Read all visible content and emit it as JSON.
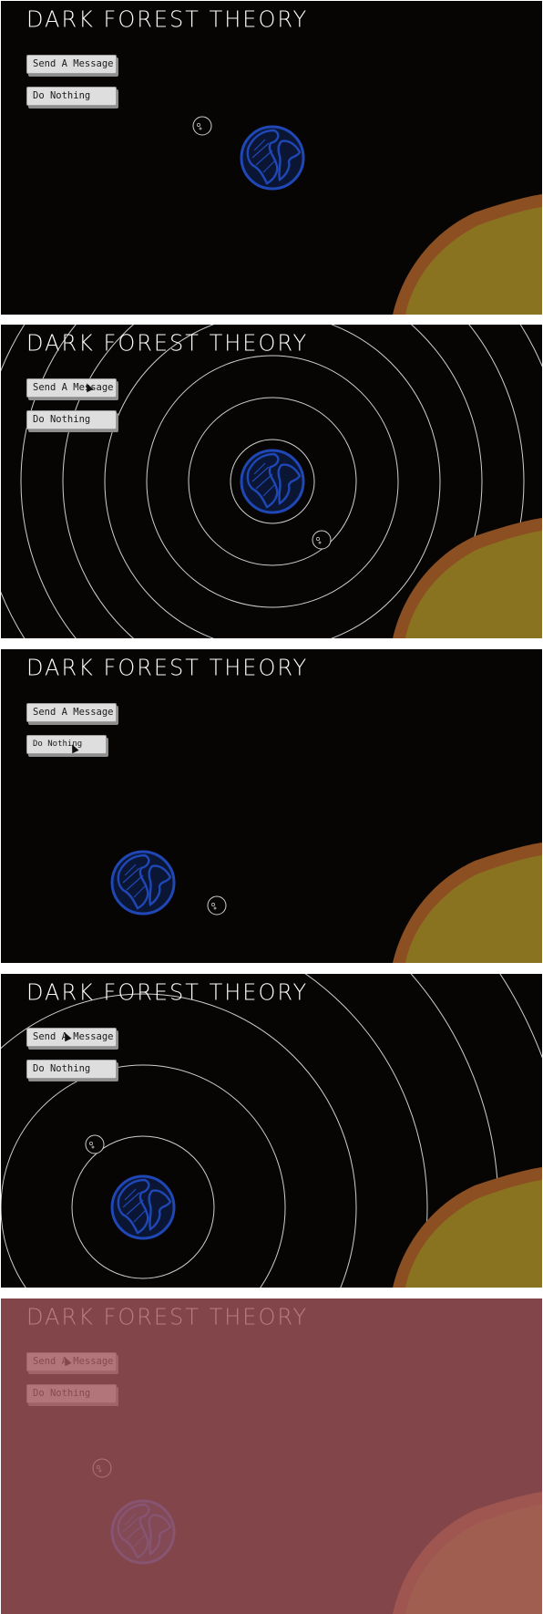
{
  "app": {
    "title": "DARK FOREST THEORY",
    "send_button_label": "Send A Message",
    "nothing_button_label": "Do Nothing"
  },
  "colors": {
    "background": "#070404",
    "sun_outer": "#8c4f22",
    "sun_inner": "#8a7320",
    "earth_ocean": "#0a1633",
    "earth_stroke": "#1f47b5",
    "signal_rings": "#cfcfcf",
    "invaded_tint": "#a5585d"
  },
  "frames": [
    {
      "name": "idle",
      "signal_rings": false,
      "invaded": false
    },
    {
      "name": "signal-sent",
      "signal_rings": true,
      "invaded": false
    },
    {
      "name": "do-nothing-pressed",
      "signal_rings": false,
      "invaded": false
    },
    {
      "name": "signal-sent-moved",
      "signal_rings": true,
      "invaded": false
    },
    {
      "name": "invaded",
      "signal_rings": false,
      "invaded": true
    }
  ]
}
